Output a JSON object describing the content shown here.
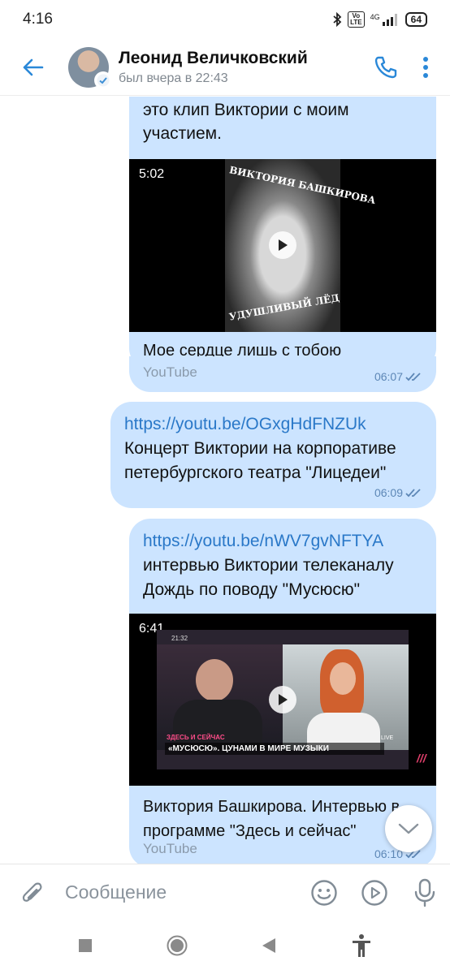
{
  "status_bar": {
    "time": "4:16",
    "network": "4G",
    "volte": "Vo\nLTE",
    "battery": "64",
    "icons": [
      "bluetooth-icon",
      "volte-icon",
      "signal-icon",
      "battery-icon"
    ]
  },
  "header": {
    "name": "Леонид Величковский",
    "status": "был вчера в 22:43",
    "icons": [
      "back-arrow-icon",
      "phone-icon",
      "more-vertical-icon"
    ],
    "accent": "#2a88d8"
  },
  "messages": [
    {
      "text": "это клип Виктории с моим участием.",
      "video": {
        "duration": "5:02",
        "cover_title": "ВИКТОРИЯ БАШКИРОВА",
        "cover_subtitle": "УДУШЛИВЫЙ ЛЁД",
        "title": "Мое сердце лишь с тобою",
        "source": "YouTube"
      },
      "time": "06:07"
    },
    {
      "link": "https://youtu.be/OGxgHdFNZUk",
      "text": "Концерт Виктории на корпоративе петербургского театра \"Лицедеи\"",
      "time": "06:09"
    },
    {
      "link": "https://youtu.be/nWV7gvNFTYA",
      "text": "интервью Виктории телеканалу Дождь по поводу \"Мусюсю\"",
      "video": {
        "duration": "6:41",
        "clock": "21:32",
        "lower_third_top": "ЗДЕСЬ И СЕЙЧАС",
        "lower_third": "«МУСЮСЮ». ЦУНАМИ В МИРЕ МУЗЫКИ",
        "live": "LIVE",
        "title": "Виктория Башкирова. Интервью в программе \"Здесь и сейчас\"",
        "source": "YouTube"
      },
      "time": "06:10"
    }
  ],
  "composer": {
    "placeholder": "Сообщение",
    "icons": [
      "paperclip-icon",
      "emoji-icon",
      "video-message-icon",
      "microphone-icon"
    ]
  },
  "colors": {
    "bubble": "#cce4ff",
    "link": "#2a78c8",
    "time": "#5d87b6"
  }
}
